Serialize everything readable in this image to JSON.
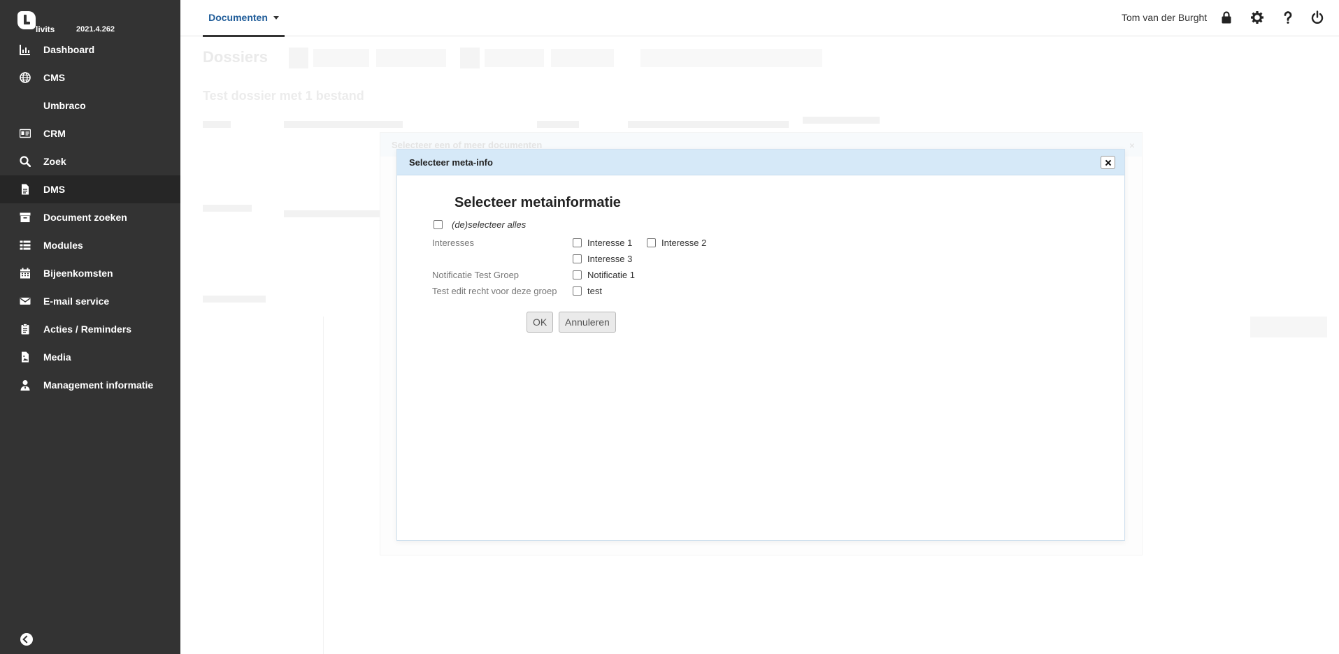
{
  "brand": {
    "name": "livits",
    "version": "2021.4.262"
  },
  "sidebar": {
    "items": [
      {
        "label": "Dashboard",
        "icon": "chart-icon"
      },
      {
        "label": "CMS",
        "icon": "globe-icon"
      },
      {
        "label": "Umbraco",
        "icon": ""
      },
      {
        "label": "CRM",
        "icon": "id-card-icon"
      },
      {
        "label": "Zoek",
        "icon": "search-icon"
      },
      {
        "label": "DMS",
        "icon": "file-icon",
        "active": true
      },
      {
        "label": "Document zoeken",
        "icon": "archive-icon"
      },
      {
        "label": "Modules",
        "icon": "list-icon"
      },
      {
        "label": "Bijeenkomsten",
        "icon": "calendar-icon"
      },
      {
        "label": "E-mail service",
        "icon": "envelope-icon"
      },
      {
        "label": "Acties / Reminders",
        "icon": "clipboard-icon"
      },
      {
        "label": "Media",
        "icon": "media-file-icon"
      },
      {
        "label": "Management informatie",
        "icon": "user-tie-icon"
      }
    ],
    "collapse_icon": "arrow-left-circle-icon"
  },
  "topbar": {
    "tab_label": "Documenten",
    "user": "Tom van der Burght",
    "icons": [
      "lock-icon",
      "gear-icon",
      "question-icon",
      "power-icon"
    ]
  },
  "background": {
    "title": "Dossiers",
    "subtitle": "Test dossier met 1 bestand"
  },
  "outer_modal": {
    "title": "Selecteer een of meer documenten",
    "close": "×"
  },
  "dialog": {
    "title": "Selecteer meta-info",
    "heading": "Selecteer metainformatie",
    "select_all": "(de)selecteer alles",
    "groups": [
      {
        "label": "Interesses",
        "options": [
          "Interesse 1",
          "Interesse 2",
          "Interesse 3"
        ]
      },
      {
        "label": "Notificatie Test Groep",
        "options": [
          "Notificatie 1"
        ]
      },
      {
        "label": "Test edit recht voor deze groep",
        "options": [
          "test"
        ]
      }
    ],
    "ok_label": "OK",
    "cancel_label": "Annuleren"
  },
  "colors": {
    "sidebar_bg": "#333333",
    "active_item_bg": "#262626",
    "tab_text": "#1f5c99",
    "dialog_header": "#d6e9f8"
  }
}
